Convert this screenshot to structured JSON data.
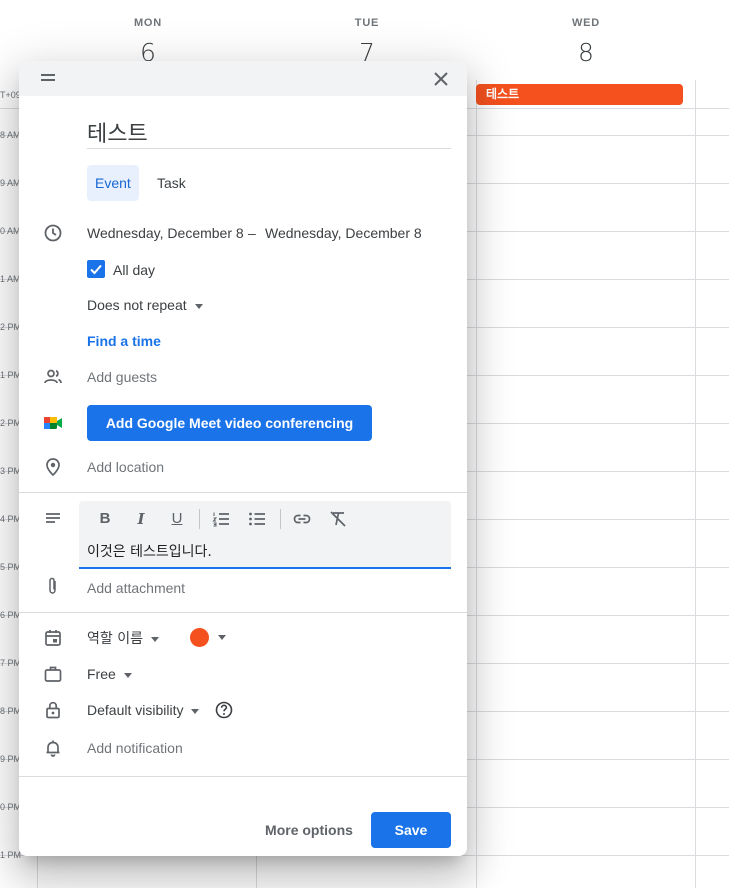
{
  "calendar": {
    "gmt_label": "T+09",
    "days": [
      {
        "name": "MON",
        "number": "6"
      },
      {
        "name": "TUE",
        "number": "7"
      },
      {
        "name": "WED",
        "number": "8"
      }
    ],
    "hour_labels": [
      "8 AM",
      "9 AM",
      "0 AM",
      "1 AM",
      "2 PM",
      "1 PM",
      "2 PM",
      "3 PM",
      "4 PM",
      "5 PM",
      "6 PM",
      "7 PM",
      "8 PM",
      "9 PM",
      "0 PM",
      "1 PM"
    ],
    "event_chip": {
      "label": "테스트",
      "color": "#f4511e"
    }
  },
  "dialog": {
    "title_value": "테스트",
    "tabs": [
      {
        "label": "Event"
      },
      {
        "label": "Task"
      }
    ],
    "date_start": "Wednesday, December 8",
    "date_separator": "–",
    "date_end": "Wednesday, December 8",
    "all_day_label": "All day",
    "all_day_checked": true,
    "repeat_label": "Does not repeat",
    "find_time_label": "Find a time",
    "add_guests_placeholder": "Add guests",
    "meet_button_label": "Add Google Meet video conferencing",
    "add_location_placeholder": "Add location",
    "description_text": "이것은 테스트입니다.",
    "toolbar": {
      "bold": "B",
      "italic": "I",
      "underline": "U"
    },
    "add_attachment_label": "Add attachment",
    "calendar_name": "역할 이름",
    "event_color": "#f4511e",
    "availability": "Free",
    "visibility": "Default visibility",
    "add_notification_label": "Add notification",
    "more_options_label": "More options",
    "save_label": "Save"
  },
  "colors": {
    "accent": "#1a73e8",
    "event": "#f4511e"
  }
}
